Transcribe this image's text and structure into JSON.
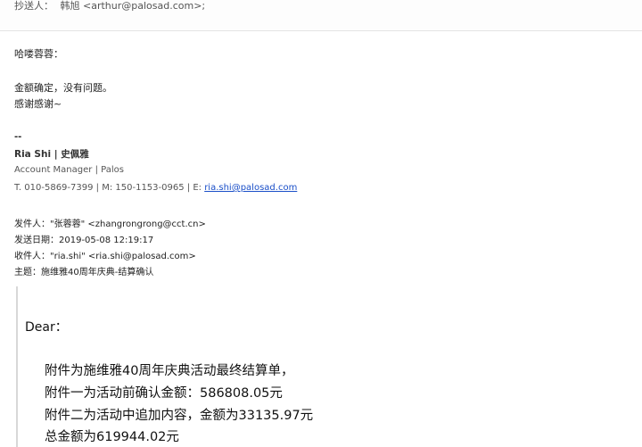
{
  "cc": {
    "label": "抄送人：",
    "value": "韩旭 <arthur@palosad.com>;"
  },
  "reply": {
    "greeting": "哈喽蓉蓉：",
    "line1": "金额确定，没有问题。",
    "line2": "感谢感谢~"
  },
  "signature": {
    "separator": "--",
    "name": "Ria Shi | 史佩雅",
    "role": "Account Manager | Palos",
    "phone_prefix": "T. 010-5869-7399 | M: 150-1153-0965 | E: ",
    "email": "ria.shi@palosad.com"
  },
  "forwarded": {
    "from": "发件人：\"张蓉蓉\" <zhangrongrong@cct.cn>",
    "date": "发送日期：2019-05-08 12:19:17",
    "to": "收件人：\"ria.shi\" <ria.shi@palosad.com>",
    "subject": "主题：施维雅40周年庆典-结算确认"
  },
  "quoted": {
    "dear": "Dear：",
    "lines": [
      "附件为施维雅40周年庆典活动最终结算单，",
      "附件一为活动前确认金额：586808.05元",
      "附件二为活动中追加内容，金额为33135.97元",
      "总金额为619944.02元"
    ]
  }
}
